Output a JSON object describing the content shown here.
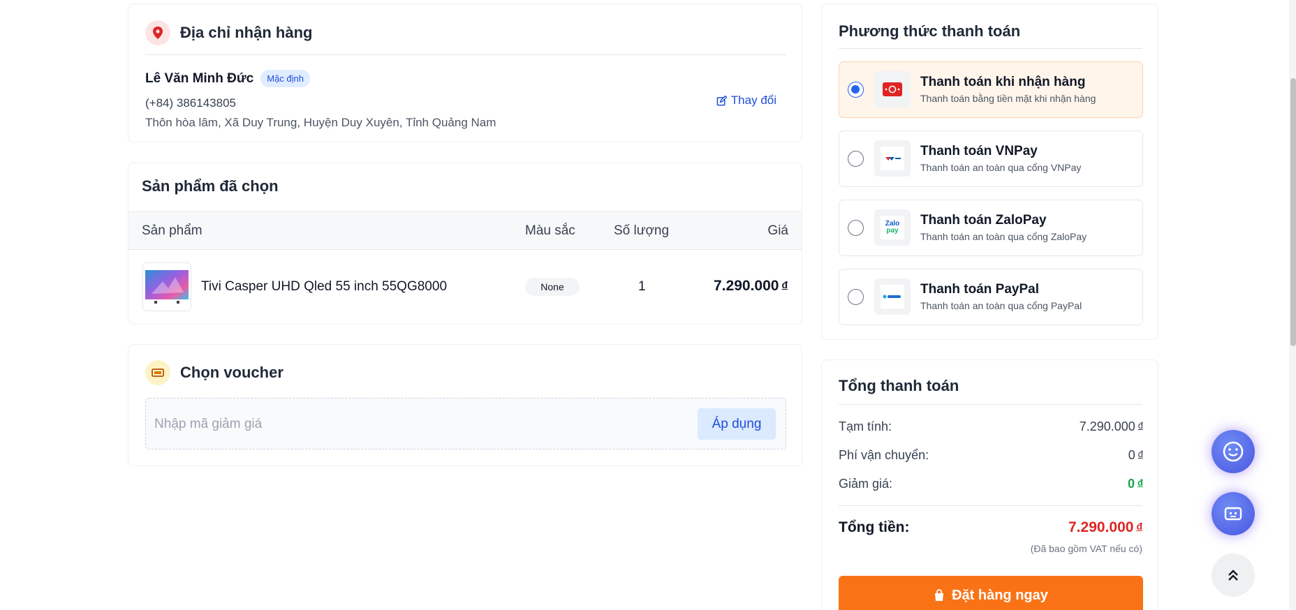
{
  "address": {
    "title": "Địa chỉ nhận hàng",
    "icon": "map-pin-icon",
    "name": "Lê Văn Minh Đức",
    "default_badge": "Mặc định",
    "phone": "(+84) 386143805",
    "full_address": "Thôn hòa lâm, Xã Duy Trung, Huyện Duy Xuyên, Tỉnh Quảng Nam",
    "change_label": "Thay đổi"
  },
  "products": {
    "title": "Sản phẩm đã chọn",
    "columns": {
      "product": "Sản phẩm",
      "color": "Màu sắc",
      "quantity": "Số lượng",
      "price": "Giá"
    },
    "items": [
      {
        "name": "Tivi Casper UHD Qled 55 inch 55QG8000",
        "color": "None",
        "quantity": "1",
        "price": "7.290.000",
        "currency": "đ"
      }
    ]
  },
  "voucher": {
    "title": "Chọn voucher",
    "icon": "ticket-icon",
    "input_value": "",
    "placeholder": "Nhập mã giảm giá",
    "apply_label": "Áp dụng"
  },
  "payment": {
    "title": "Phương thức thanh toán",
    "selected": "cod",
    "options": [
      {
        "id": "cod",
        "title": "Thanh toán khi nhận hàng",
        "subtitle": "Thanh toán bằng tiền mặt khi nhận hàng",
        "icon": "cash-icon"
      },
      {
        "id": "vnpay",
        "title": "Thanh toán VNPay",
        "subtitle": "Thanh toán an toàn qua cổng VNPay",
        "icon": "vnpay-logo"
      },
      {
        "id": "zalopay",
        "title": "Thanh toán ZaloPay",
        "subtitle": "Thanh toán an toàn qua cổng ZaloPay",
        "icon": "zalopay-logo"
      },
      {
        "id": "paypal",
        "title": "Thanh toán PayPal",
        "subtitle": "Thanh toán an toàn qua cổng PayPal",
        "icon": "paypal-logo"
      }
    ]
  },
  "totals": {
    "title": "Tổng thanh toán",
    "subtotal_label": "Tạm tính:",
    "subtotal_value": "7.290.000",
    "shipping_label": "Phí vận chuyển:",
    "shipping_value": "0",
    "discount_label": "Giảm giá:",
    "discount_value": "0",
    "currency": "đ",
    "grand_label": "Tổng tiền:",
    "grand_value": "7.290.000",
    "vat_note": "(Đã bao gồm VAT nếu có)",
    "order_label": "Đặt hàng ngay",
    "order_icon": "shopping-bag-icon"
  },
  "floating": {
    "chat_icon": "chat-bubble-icon",
    "bot_icon": "chatbot-icon",
    "top_icon": "double-chevron-up-icon"
  },
  "colors": {
    "accent_blue": "#2563eb",
    "order_orange": "#f97316",
    "total_red": "#dc2626",
    "discount_green": "#16a34a"
  }
}
